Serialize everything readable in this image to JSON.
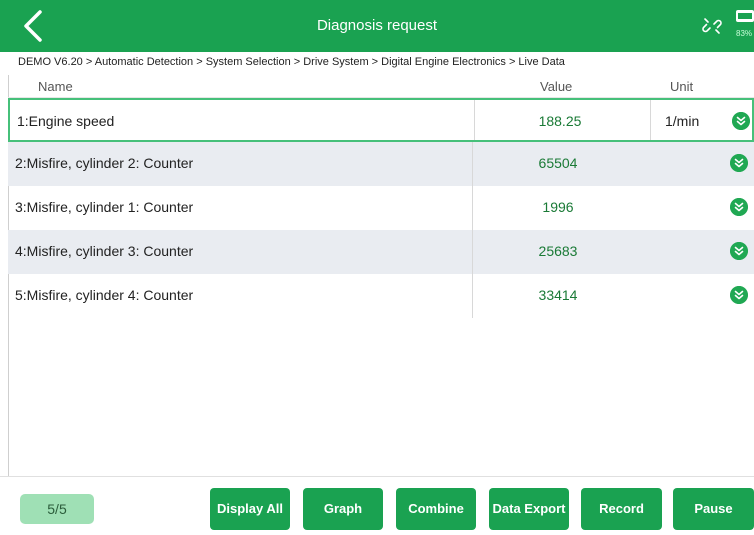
{
  "header": {
    "title": "Diagnosis request",
    "back_icon": "chevron-left-icon",
    "link_icon": "link-broken-icon",
    "battery_percent": "83%"
  },
  "breadcrumb": "DEMO V6.20 > Automatic Detection  > System Selection  > Drive System  > Digital Engine Electronics  > Live Data",
  "table": {
    "columns": [
      "Name",
      "Value",
      "Unit"
    ],
    "rows": [
      {
        "name": "1:Engine speed",
        "value": "188.25",
        "unit": "1/min"
      },
      {
        "name": "2:Misfire, cylinder 2: Counter",
        "value": "65504",
        "unit": ""
      },
      {
        "name": "3:Misfire, cylinder 1: Counter",
        "value": "1996",
        "unit": ""
      },
      {
        "name": "4:Misfire, cylinder 3: Counter",
        "value": "25683",
        "unit": ""
      },
      {
        "name": "5:Misfire, cylinder 4: Counter",
        "value": "33414",
        "unit": ""
      }
    ]
  },
  "footer": {
    "page_indicator": "5/5",
    "buttons": [
      "Display All",
      "Graph",
      "Combine",
      "Data Export",
      "Record",
      "Pause"
    ]
  },
  "colors": {
    "brand_green": "#1aa251",
    "value_green": "#1a7a36",
    "row_alt": "#e9ecf1",
    "selected_border": "#46c07a"
  }
}
